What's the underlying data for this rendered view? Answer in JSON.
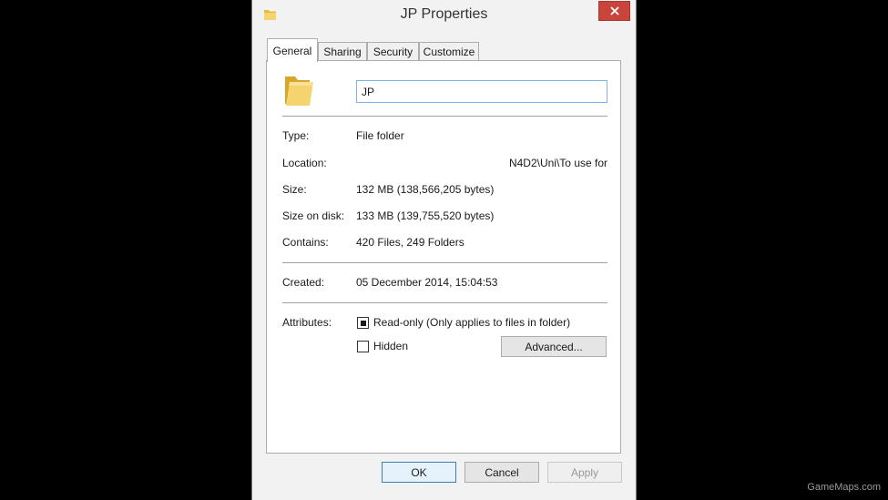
{
  "window": {
    "title": "JP Properties"
  },
  "tabs": [
    {
      "label": "General",
      "active": true
    },
    {
      "label": "Sharing",
      "active": false
    },
    {
      "label": "Security",
      "active": false
    },
    {
      "label": "Customize",
      "active": false
    }
  ],
  "general": {
    "name_value": "JP",
    "type": {
      "label": "Type:",
      "value": "File folder"
    },
    "location": {
      "label": "Location:",
      "value": "N4D2\\Uni\\To use for"
    },
    "size": {
      "label": "Size:",
      "value": "132 MB (138,566,205 bytes)"
    },
    "size_on_disk": {
      "label": "Size on disk:",
      "value": "133 MB (139,755,520 bytes)"
    },
    "contains": {
      "label": "Contains:",
      "value": "420 Files, 249 Folders"
    },
    "created": {
      "label": "Created:",
      "value": "05 December 2014, 15:04:53"
    },
    "attributes": {
      "label": "Attributes:",
      "read_only": {
        "label": "Read-only (Only applies to files in folder)",
        "state": "indeterminate"
      },
      "hidden": {
        "label": "Hidden",
        "state": "unchecked"
      },
      "advanced_label": "Advanced..."
    }
  },
  "footer": {
    "ok_label": "OK",
    "cancel_label": "Cancel",
    "apply_label": "Apply"
  },
  "watermark": "GameMaps.com",
  "colors": {
    "close_button": "#c9453c",
    "folder": "#f2c94c",
    "input_border": "#7eb4ea"
  },
  "icons": {
    "title": "folder-icon",
    "main": "folder-icon",
    "close": "close-icon"
  }
}
